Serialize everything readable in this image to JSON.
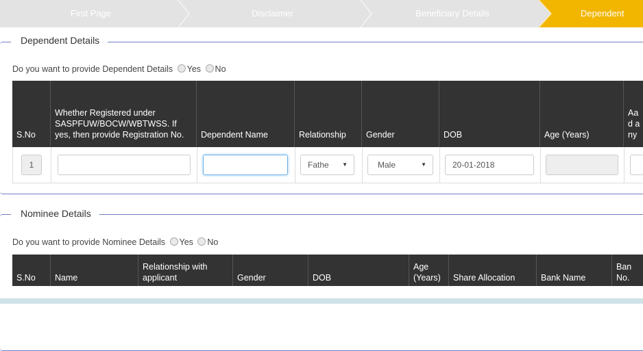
{
  "steps": [
    "First Page",
    "Disclaimer",
    "Beneficiary Details",
    "Dependent"
  ],
  "dependent": {
    "legend": "Dependent Details",
    "question": "Do you want to provide Dependent Details",
    "yes": "Yes",
    "no": "No",
    "headers": [
      "S.No",
      "Whether Registered under SASPFUW/BOCW/WBTWSS. If yes, then provide Registration No.",
      "Dependent Name",
      "Relationship",
      "Gender",
      "DOB",
      "Age (Years)",
      "Aad any"
    ],
    "row": {
      "sno": "1",
      "registration": "",
      "name": "",
      "relationship": "Fathe",
      "gender": "Male",
      "dob": "20-01-2018",
      "age": ""
    }
  },
  "nominee": {
    "legend": "Nominee Details",
    "question": "Do you want to provide Nominee Details",
    "yes": "Yes",
    "no": "No",
    "headers": [
      "S.No",
      "Name",
      "Relationship with applicant",
      "Gender",
      "DOB",
      "Age (Years)",
      "Share Allocation",
      "Bank Name",
      "Ban No."
    ]
  }
}
